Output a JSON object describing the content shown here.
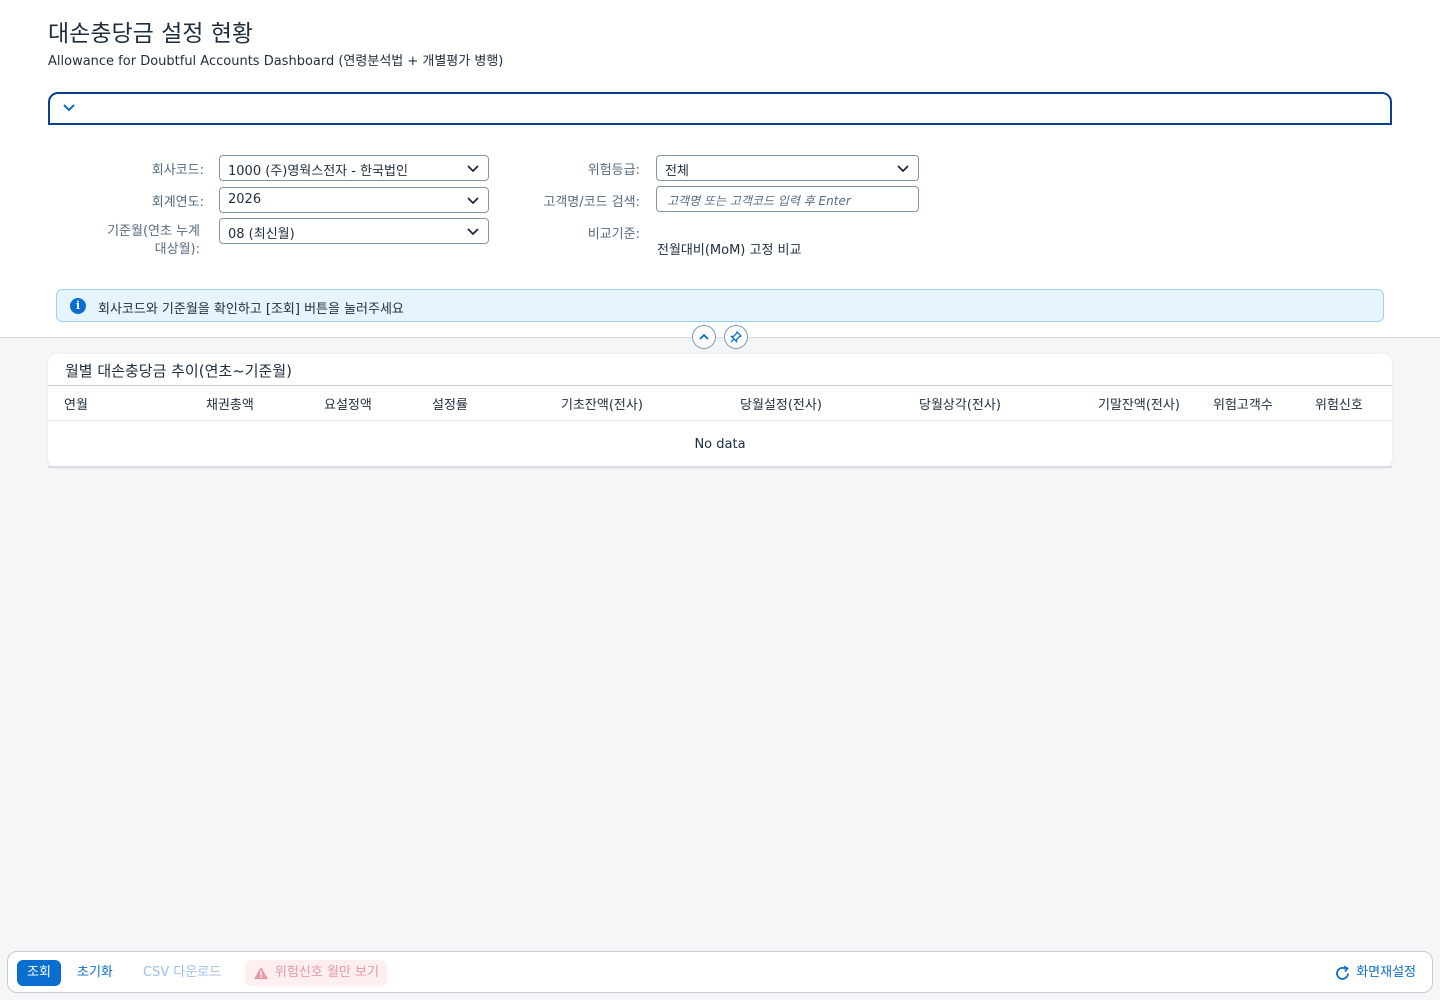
{
  "page": {
    "title": "대손충당금 설정 현황",
    "subtitle": "Allowance for Doubtful Accounts Dashboard (연령분석법 + 개별평가 병행)"
  },
  "filters": {
    "company_label": "회사코드:",
    "company_value": "1000 (주)영웍스전자 - 한국법인",
    "fiscal_year_label": "회계연도:",
    "fiscal_year_value": "2026",
    "base_month_label_line1": "기준월(연초 누계",
    "base_month_label_line2": "대상월):",
    "base_month_value": "08 (최신월)",
    "risk_grade_label": "위험등급:",
    "risk_grade_value": "전체",
    "customer_search_label": "고객명/코드 검색:",
    "customer_search_placeholder": "고객명 또는 고객코드 입력 후 Enter",
    "compare_label": "비교기준:",
    "compare_value": "전월대비(MoM) 고정 비교"
  },
  "info_message": "회사코드와 기준월을 확인하고 [조회] 버튼을 눌러주세요",
  "table": {
    "title": "월별 대손충당금 추이(연초~기준월)",
    "columns": [
      "연월",
      "채권총액",
      "요설정액",
      "설정률",
      "기초잔액(전사)",
      "당월설정(전사)",
      "당월상각(전사)",
      "기말잔액(전사)",
      "위험고객수",
      "위험신호"
    ],
    "empty_text": "No data"
  },
  "footer": {
    "search_button": "조회",
    "reset_button": "초기화",
    "csv_button": "CSV 다운로드",
    "risk_only_button": "위험신호 월만 보기",
    "screen_reset_button": "화면재설정"
  },
  "colors": {
    "brand": "#0a6ed1",
    "focus_border": "#0a3f8f",
    "info_bg": "#e5f4fd",
    "danger_bg": "#fdeef0"
  }
}
